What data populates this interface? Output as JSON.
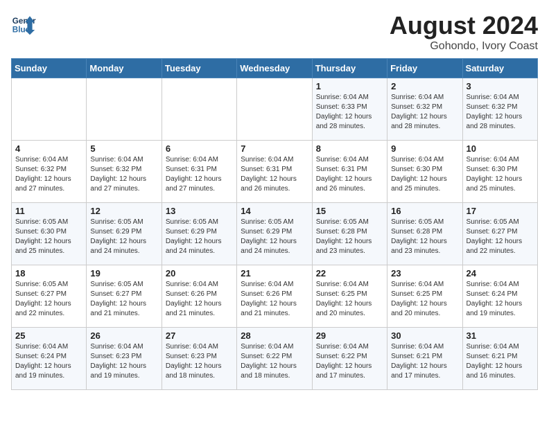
{
  "header": {
    "logo_line1": "General",
    "logo_line2": "Blue",
    "month_year": "August 2024",
    "location": "Gohondo, Ivory Coast"
  },
  "weekdays": [
    "Sunday",
    "Monday",
    "Tuesday",
    "Wednesday",
    "Thursday",
    "Friday",
    "Saturday"
  ],
  "weeks": [
    [
      {
        "day": "",
        "info": ""
      },
      {
        "day": "",
        "info": ""
      },
      {
        "day": "",
        "info": ""
      },
      {
        "day": "",
        "info": ""
      },
      {
        "day": "1",
        "info": "Sunrise: 6:04 AM\nSunset: 6:33 PM\nDaylight: 12 hours\nand 28 minutes."
      },
      {
        "day": "2",
        "info": "Sunrise: 6:04 AM\nSunset: 6:32 PM\nDaylight: 12 hours\nand 28 minutes."
      },
      {
        "day": "3",
        "info": "Sunrise: 6:04 AM\nSunset: 6:32 PM\nDaylight: 12 hours\nand 28 minutes."
      }
    ],
    [
      {
        "day": "4",
        "info": "Sunrise: 6:04 AM\nSunset: 6:32 PM\nDaylight: 12 hours\nand 27 minutes."
      },
      {
        "day": "5",
        "info": "Sunrise: 6:04 AM\nSunset: 6:32 PM\nDaylight: 12 hours\nand 27 minutes."
      },
      {
        "day": "6",
        "info": "Sunrise: 6:04 AM\nSunset: 6:31 PM\nDaylight: 12 hours\nand 27 minutes."
      },
      {
        "day": "7",
        "info": "Sunrise: 6:04 AM\nSunset: 6:31 PM\nDaylight: 12 hours\nand 26 minutes."
      },
      {
        "day": "8",
        "info": "Sunrise: 6:04 AM\nSunset: 6:31 PM\nDaylight: 12 hours\nand 26 minutes."
      },
      {
        "day": "9",
        "info": "Sunrise: 6:04 AM\nSunset: 6:30 PM\nDaylight: 12 hours\nand 25 minutes."
      },
      {
        "day": "10",
        "info": "Sunrise: 6:04 AM\nSunset: 6:30 PM\nDaylight: 12 hours\nand 25 minutes."
      }
    ],
    [
      {
        "day": "11",
        "info": "Sunrise: 6:05 AM\nSunset: 6:30 PM\nDaylight: 12 hours\nand 25 minutes."
      },
      {
        "day": "12",
        "info": "Sunrise: 6:05 AM\nSunset: 6:29 PM\nDaylight: 12 hours\nand 24 minutes."
      },
      {
        "day": "13",
        "info": "Sunrise: 6:05 AM\nSunset: 6:29 PM\nDaylight: 12 hours\nand 24 minutes."
      },
      {
        "day": "14",
        "info": "Sunrise: 6:05 AM\nSunset: 6:29 PM\nDaylight: 12 hours\nand 24 minutes."
      },
      {
        "day": "15",
        "info": "Sunrise: 6:05 AM\nSunset: 6:28 PM\nDaylight: 12 hours\nand 23 minutes."
      },
      {
        "day": "16",
        "info": "Sunrise: 6:05 AM\nSunset: 6:28 PM\nDaylight: 12 hours\nand 23 minutes."
      },
      {
        "day": "17",
        "info": "Sunrise: 6:05 AM\nSunset: 6:27 PM\nDaylight: 12 hours\nand 22 minutes."
      }
    ],
    [
      {
        "day": "18",
        "info": "Sunrise: 6:05 AM\nSunset: 6:27 PM\nDaylight: 12 hours\nand 22 minutes."
      },
      {
        "day": "19",
        "info": "Sunrise: 6:05 AM\nSunset: 6:27 PM\nDaylight: 12 hours\nand 21 minutes."
      },
      {
        "day": "20",
        "info": "Sunrise: 6:04 AM\nSunset: 6:26 PM\nDaylight: 12 hours\nand 21 minutes."
      },
      {
        "day": "21",
        "info": "Sunrise: 6:04 AM\nSunset: 6:26 PM\nDaylight: 12 hours\nand 21 minutes."
      },
      {
        "day": "22",
        "info": "Sunrise: 6:04 AM\nSunset: 6:25 PM\nDaylight: 12 hours\nand 20 minutes."
      },
      {
        "day": "23",
        "info": "Sunrise: 6:04 AM\nSunset: 6:25 PM\nDaylight: 12 hours\nand 20 minutes."
      },
      {
        "day": "24",
        "info": "Sunrise: 6:04 AM\nSunset: 6:24 PM\nDaylight: 12 hours\nand 19 minutes."
      }
    ],
    [
      {
        "day": "25",
        "info": "Sunrise: 6:04 AM\nSunset: 6:24 PM\nDaylight: 12 hours\nand 19 minutes."
      },
      {
        "day": "26",
        "info": "Sunrise: 6:04 AM\nSunset: 6:23 PM\nDaylight: 12 hours\nand 19 minutes."
      },
      {
        "day": "27",
        "info": "Sunrise: 6:04 AM\nSunset: 6:23 PM\nDaylight: 12 hours\nand 18 minutes."
      },
      {
        "day": "28",
        "info": "Sunrise: 6:04 AM\nSunset: 6:22 PM\nDaylight: 12 hours\nand 18 minutes."
      },
      {
        "day": "29",
        "info": "Sunrise: 6:04 AM\nSunset: 6:22 PM\nDaylight: 12 hours\nand 17 minutes."
      },
      {
        "day": "30",
        "info": "Sunrise: 6:04 AM\nSunset: 6:21 PM\nDaylight: 12 hours\nand 17 minutes."
      },
      {
        "day": "31",
        "info": "Sunrise: 6:04 AM\nSunset: 6:21 PM\nDaylight: 12 hours\nand 16 minutes."
      }
    ]
  ]
}
